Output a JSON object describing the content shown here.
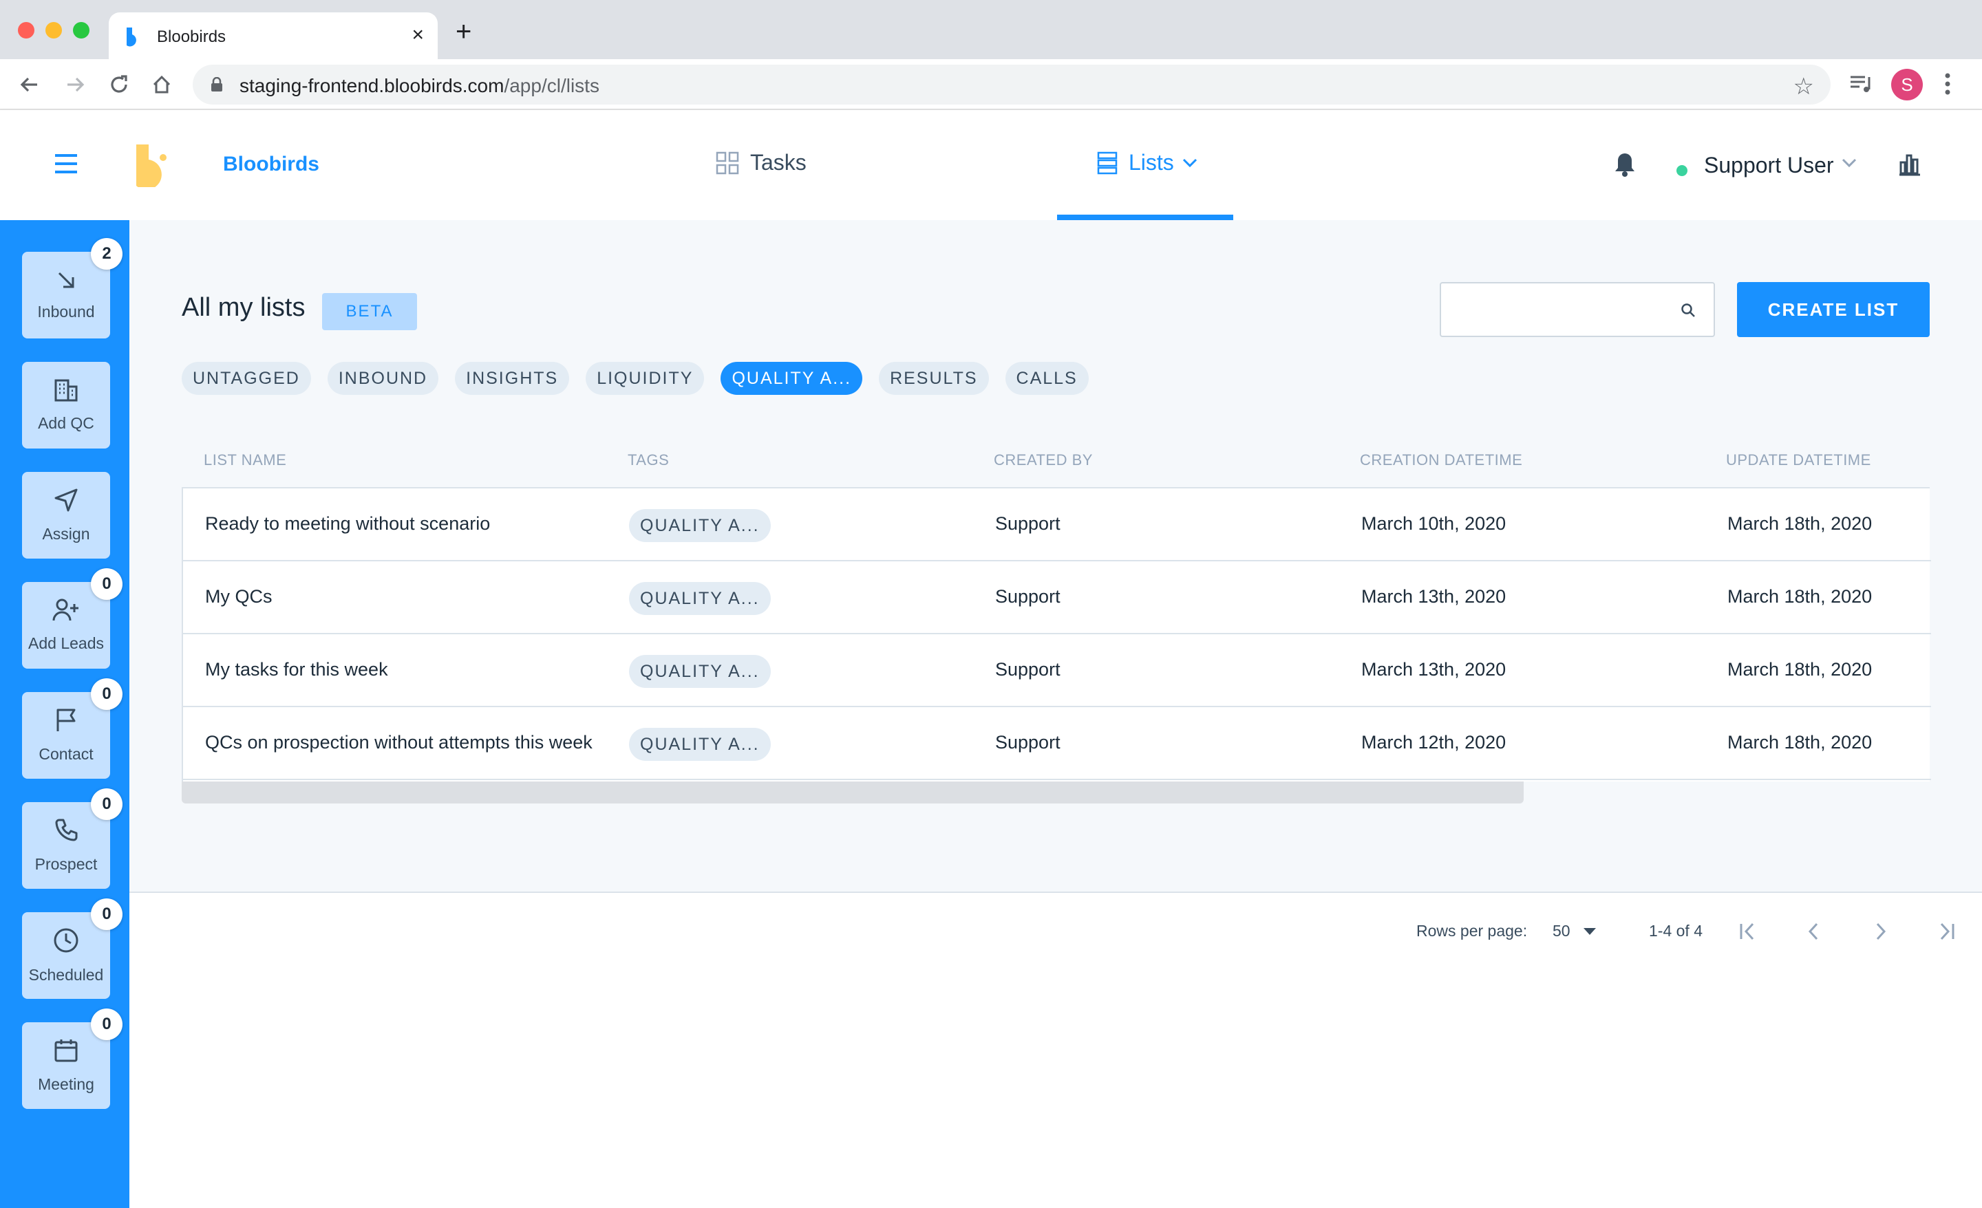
{
  "browser": {
    "tab_title": "Bloobirds",
    "new_tab": "+",
    "close": "×",
    "url_host": "staging-frontend.bloobirds.com",
    "url_path": "/app/cl/lists",
    "profile_initial": "S"
  },
  "header": {
    "brand": "Bloobirds",
    "nav": {
      "tasks": "Tasks",
      "lists": "Lists"
    },
    "user_name": "Support User"
  },
  "sidebar": {
    "items": [
      {
        "label": "Inbound",
        "icon": "arrow-down-right-icon",
        "badge": "2"
      },
      {
        "label": "Add QC",
        "icon": "building-icon",
        "badge": ""
      },
      {
        "label": "Assign",
        "icon": "send-icon",
        "badge": ""
      },
      {
        "label": "Add Leads",
        "icon": "user-plus-icon",
        "badge": "0"
      },
      {
        "label": "Contact",
        "icon": "flag-icon",
        "badge": "0"
      },
      {
        "label": "Prospect",
        "icon": "phone-icon",
        "badge": "0"
      },
      {
        "label": "Scheduled",
        "icon": "clock-icon",
        "badge": "0"
      },
      {
        "label": "Meeting",
        "icon": "calendar-icon",
        "badge": "0"
      }
    ]
  },
  "main": {
    "title": "All my lists",
    "beta": "BETA",
    "search_placeholder": "",
    "create_label": "CREATE LIST",
    "tags": [
      "UNTAGGED",
      "INBOUND",
      "INSIGHTS",
      "LIQUIDITY",
      "QUALITY A...",
      "RESULTS",
      "CALLS"
    ],
    "active_tag_index": 4,
    "columns": [
      "LIST NAME",
      "TAGS",
      "CREATED BY",
      "CREATION DATETIME",
      "UPDATE DATETIME"
    ],
    "rows": [
      {
        "name": "Ready to meeting without scenario",
        "tag": "QUALITY A...",
        "created_by": "Support",
        "created": "March 10th, 2020",
        "updated": "March 18th, 2020"
      },
      {
        "name": "My QCs",
        "tag": "QUALITY A...",
        "created_by": "Support",
        "created": "March 13th, 2020",
        "updated": "March 18th, 2020"
      },
      {
        "name": "My tasks for this week",
        "tag": "QUALITY A...",
        "created_by": "Support",
        "created": "March 13th, 2020",
        "updated": "March 18th, 2020"
      },
      {
        "name": "QCs on prospection without attempts this week",
        "tag": "QUALITY A...",
        "created_by": "Support",
        "created": "March 12th, 2020",
        "updated": "March 18th, 2020"
      }
    ],
    "pagination": {
      "rows_per_page_label": "Rows per page:",
      "rows_per_page": "50",
      "range": "1-4 of 4"
    }
  },
  "colors": {
    "primary": "#1991ff",
    "sidebar_button": "#c5e1ff",
    "logo": "#ffd166",
    "online": "#3ad39e"
  }
}
